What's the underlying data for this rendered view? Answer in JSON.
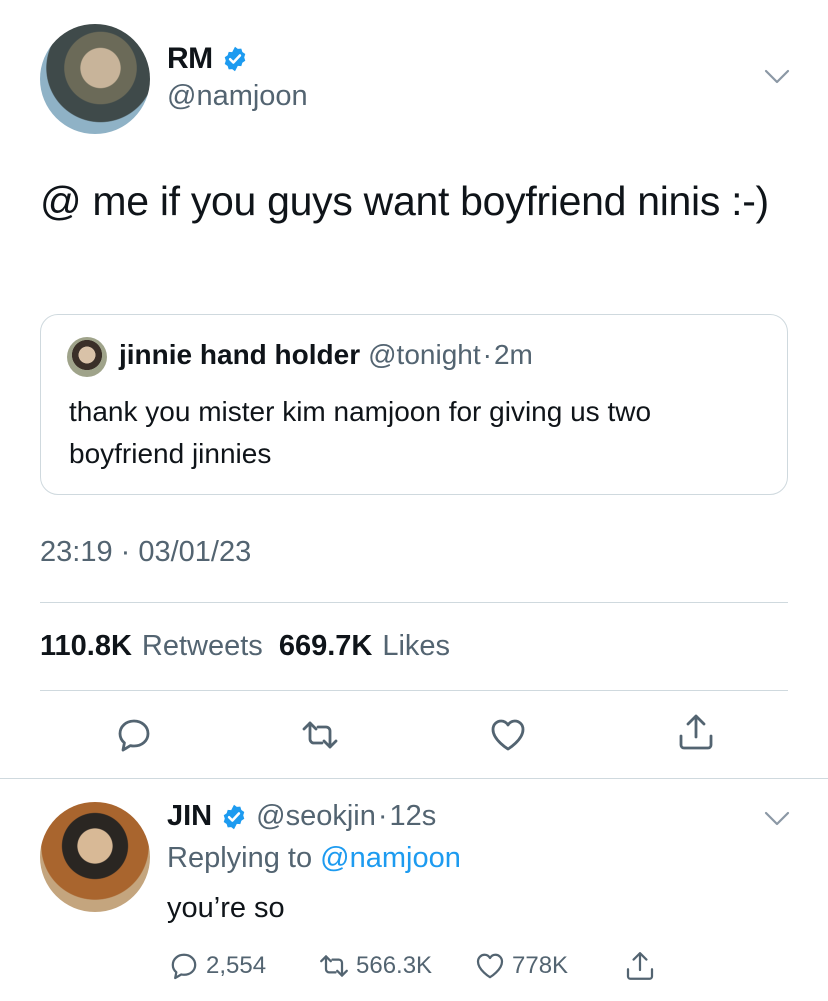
{
  "main_tweet": {
    "name": "RM",
    "handle": "@namjoon",
    "text": "@ me if you guys want boyfriend ninis :-)",
    "timestamp": "23:19 · 03/01/23",
    "retweets": "110.8K",
    "retweets_label": "Retweets",
    "likes": "669.7K",
    "likes_label": "Likes"
  },
  "quote": {
    "name": "jinnie hand holder",
    "handle": "@tonight",
    "dot": "·",
    "time": "2m",
    "text": "thank you mister kim namjoon for giving us two boyfriend jinnies"
  },
  "reply_tweet": {
    "name": "JIN",
    "handle": "@seokjin",
    "dot": "·",
    "time": "12s",
    "replying_prefix": "Replying to",
    "replying_handle": "@namjoon",
    "text": "you’re so",
    "reply_count": "2,554",
    "retweet_count": "566.3K",
    "like_count": "778K"
  },
  "colors": {
    "accent": "#1d9bf0",
    "muted": "#536471",
    "text": "#0f1419",
    "border": "#cfd9de"
  },
  "icons": [
    "verified-badge-icon",
    "chevron-down-icon",
    "reply-icon",
    "retweet-icon",
    "like-icon",
    "share-icon"
  ]
}
